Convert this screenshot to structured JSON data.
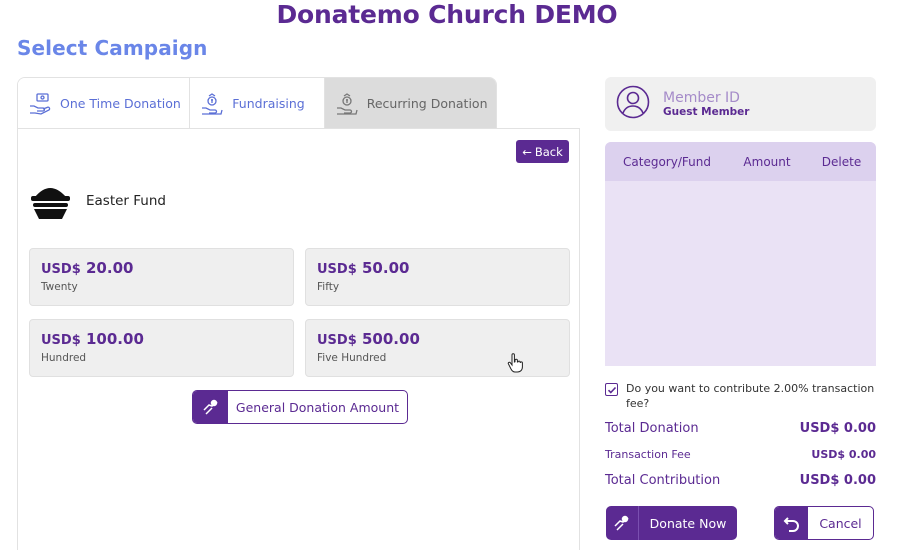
{
  "app": {
    "title": "Donatemo Church DEMO"
  },
  "section": {
    "title": "Select Campaign"
  },
  "tabs": [
    {
      "label": "One Time Donation",
      "icon": "hand-money-icon",
      "active": false
    },
    {
      "label": "Fundraising",
      "icon": "fundraising-icon",
      "active": false
    },
    {
      "label": "Recurring Donation",
      "icon": "recurring-icon",
      "active": true
    }
  ],
  "panel": {
    "back_label": "Back",
    "fund": {
      "name": "Easter Fund",
      "icon": "easter-basket-icon"
    },
    "amounts": [
      {
        "currency": "USD$",
        "value": "20.00",
        "label": "Twenty"
      },
      {
        "currency": "USD$",
        "value": "50.00",
        "label": "Fifty"
      },
      {
        "currency": "USD$",
        "value": "100.00",
        "label": "Hundred"
      },
      {
        "currency": "USD$",
        "value": "500.00",
        "label": "Five Hundred"
      }
    ],
    "general_label": "General Donation Amount"
  },
  "member": {
    "label": "Member ID",
    "value": "Guest Member",
    "icon": "user-circle-icon"
  },
  "cart": {
    "columns": [
      "Category/Fund",
      "Amount",
      "Delete"
    ]
  },
  "fee": {
    "checked": true,
    "text": "Do you want to contribute 2.00% transaction fee?"
  },
  "summary": {
    "total_donation_label": "Total Donation",
    "total_donation_value": "USD$ 0.00",
    "transaction_fee_label": "Transaction Fee",
    "transaction_fee_value": "USD$ 0.00",
    "total_contribution_label": "Total Contribution",
    "total_contribution_value": "USD$ 0.00"
  },
  "actions": {
    "donate_label": "Donate Now",
    "cancel_label": "Cancel"
  },
  "colors": {
    "primary": "#5b2a92",
    "accent": "#6a86e8",
    "cart_bg": "#eae2f5"
  }
}
